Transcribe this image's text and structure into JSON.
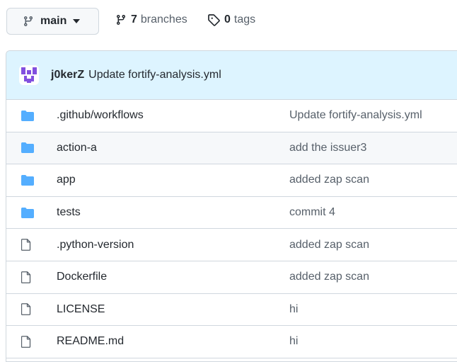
{
  "branch": {
    "name": "main",
    "icon": "git-branch-icon"
  },
  "branches": {
    "count": "7",
    "label": "branches",
    "icon": "git-branch-icon"
  },
  "tags": {
    "count": "0",
    "label": "tags",
    "icon": "tag-icon"
  },
  "latest_commit": {
    "author": "j0kerZ",
    "message": "Update fortify-analysis.yml",
    "avatar_color": "#8250df"
  },
  "colors": {
    "folder": "#54aeff",
    "file": "#57606a",
    "header_bg": "#ddf4ff"
  },
  "files": [
    {
      "name": ".github/workflows",
      "message": "Update fortify-analysis.yml",
      "type": "folder"
    },
    {
      "name": "action-a",
      "message": "add the issuer3",
      "type": "folder"
    },
    {
      "name": "app",
      "message": "added zap scan",
      "type": "folder"
    },
    {
      "name": "tests",
      "message": "commit 4",
      "type": "folder"
    },
    {
      "name": ".python-version",
      "message": "added zap scan",
      "type": "file"
    },
    {
      "name": "Dockerfile",
      "message": "added zap scan",
      "type": "file"
    },
    {
      "name": "LICENSE",
      "message": "hi",
      "type": "file"
    },
    {
      "name": "README.md",
      "message": "hi",
      "type": "file"
    }
  ]
}
